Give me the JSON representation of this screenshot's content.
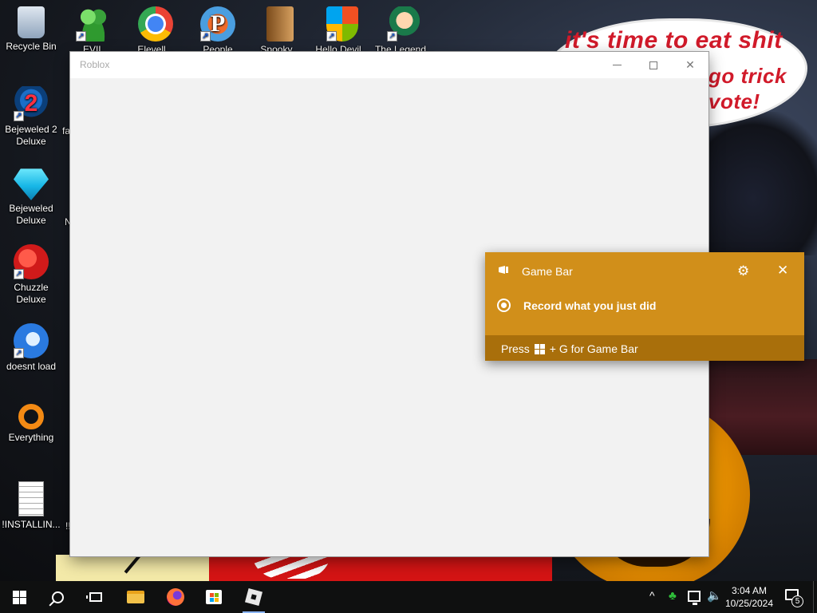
{
  "desktop": {
    "speech_bubble": {
      "line1": "it's time to eat shit",
      "line2": "go trick",
      "line3": "vote!"
    },
    "icons_left": [
      {
        "label": "Recycle Bin",
        "icon": "recycle-bin-icon"
      },
      {
        "label": "Bejeweled 2 Deluxe",
        "icon": "bejeweled2-icon"
      },
      {
        "label": "Bejeweled Deluxe",
        "icon": "bejeweled-icon"
      },
      {
        "label": "Chuzzle Deluxe",
        "icon": "chuzzle-icon"
      },
      {
        "label": "doesnt load",
        "icon": "thunderbird-icon"
      },
      {
        "label": "Everything",
        "icon": "everything-search-icon"
      },
      {
        "label": "!INSTALLIN...",
        "icon": "text-document-icon"
      }
    ],
    "icons_top": [
      {
        "label": "EVIL GREEN...",
        "icon": "people-icon"
      },
      {
        "label": "Elevell...",
        "icon": "chrome-icon"
      },
      {
        "label": "People Night...",
        "icon": "p-app-icon"
      },
      {
        "label": "Spooky...",
        "icon": "book-icon"
      },
      {
        "label": "Hello Devil...",
        "icon": "shield-icon"
      },
      {
        "label": "The Legend...",
        "icon": "character-icon"
      }
    ],
    "partial_labels": [
      "fa",
      "N",
      "!!"
    ]
  },
  "window": {
    "title": "Roblox",
    "minimize_glyph": "—",
    "close_glyph": "✕"
  },
  "gamebar": {
    "title": "Game Bar",
    "gear_glyph": "⚙",
    "close_glyph": "✕",
    "record_label": "Record what you just did",
    "hint_before": "Press",
    "hint_after": "+ G for Game Bar",
    "color_bg": "#d18f1a",
    "color_footer": "#a96f0b"
  },
  "taskbar": {
    "apps": [
      {
        "name": "start",
        "icon": "windows-logo-icon"
      },
      {
        "name": "search",
        "icon": "search-icon"
      },
      {
        "name": "task-view",
        "icon": "task-view-icon"
      },
      {
        "name": "file-explorer",
        "icon": "folder-icon"
      },
      {
        "name": "firefox",
        "icon": "firefox-icon"
      },
      {
        "name": "microsoft-store",
        "icon": "store-icon"
      },
      {
        "name": "roblox",
        "icon": "roblox-icon",
        "active": true
      }
    ],
    "tray": {
      "chevron_glyph": "^",
      "clover_glyph": "♣",
      "volume_glyph": "🔈"
    },
    "clock": {
      "time": "3:04 AM",
      "date": "10/25/2024"
    },
    "notifications_count": "5"
  }
}
